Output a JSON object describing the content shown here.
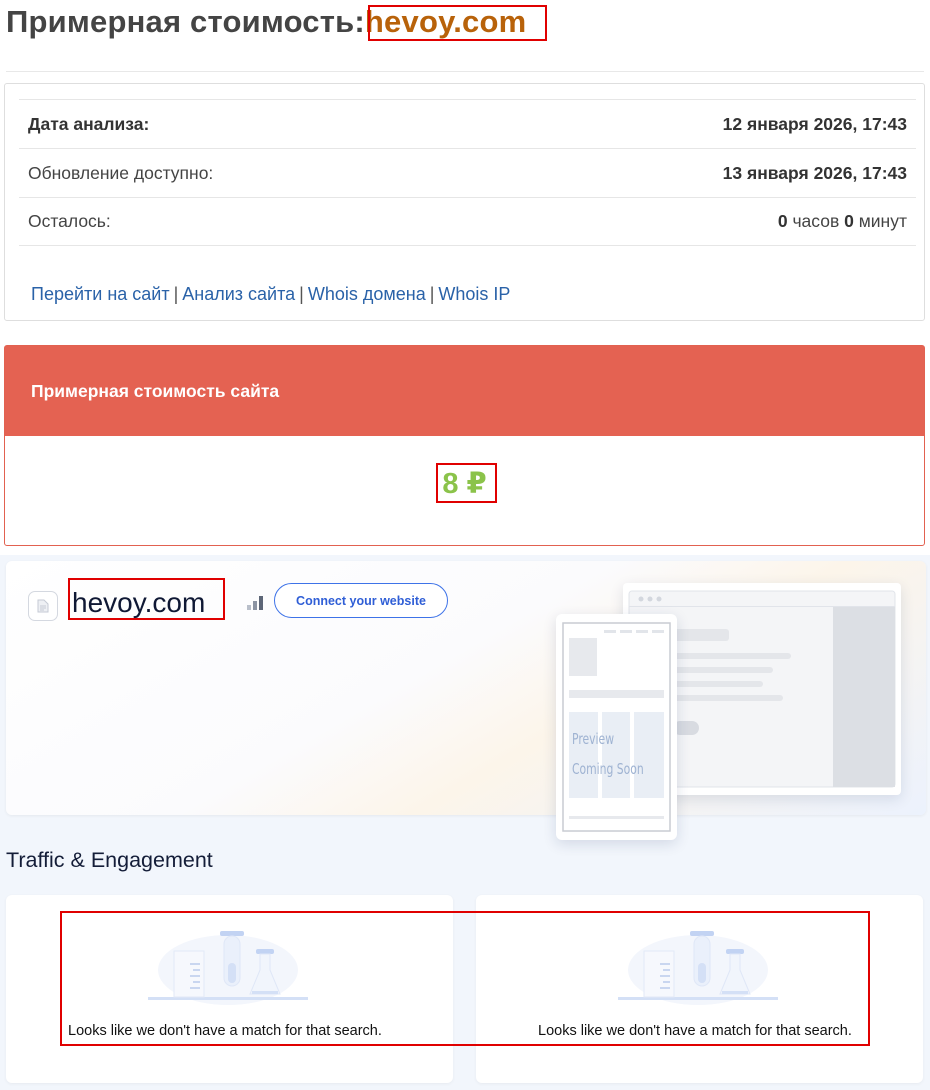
{
  "title": {
    "prefix": "Примерная стоимость:",
    "domain": "hevoy.com"
  },
  "info": {
    "rows": [
      {
        "label": "Дата анализа:",
        "value": "12 января 2026, 17:43"
      },
      {
        "label": "Обновление доступно:",
        "value": "13 января 2026, 17:43"
      },
      {
        "label": "Осталось:",
        "value_hours": "0",
        "hours_unit": "часов",
        "value_minutes": "0",
        "minutes_unit": "минут"
      }
    ],
    "links": [
      "Перейти на сайт",
      "Анализ сайта",
      "Whois домена",
      "Whois IP"
    ],
    "link_separator": "|"
  },
  "price": {
    "header": "Примерная стоимость сайта",
    "value": "8 ₽",
    "value_color": "#8bc34a",
    "header_color": "#e46252"
  },
  "similarweb": {
    "domain": "hevoy.com",
    "connect_label": "Connect your website",
    "preview_line1": "Preview",
    "preview_line2": "Coming Soon",
    "traffic_title": "Traffic & Engagement",
    "empty_message": "Looks like we don't have a match for that search.",
    "icons": [
      "favicon-placeholder-icon",
      "rank-bars-icon",
      "empty-lab-illustration"
    ]
  },
  "colors": {
    "highlight": "#e00000",
    "title_domain": "#b8620a",
    "link": "#2a62a8"
  }
}
